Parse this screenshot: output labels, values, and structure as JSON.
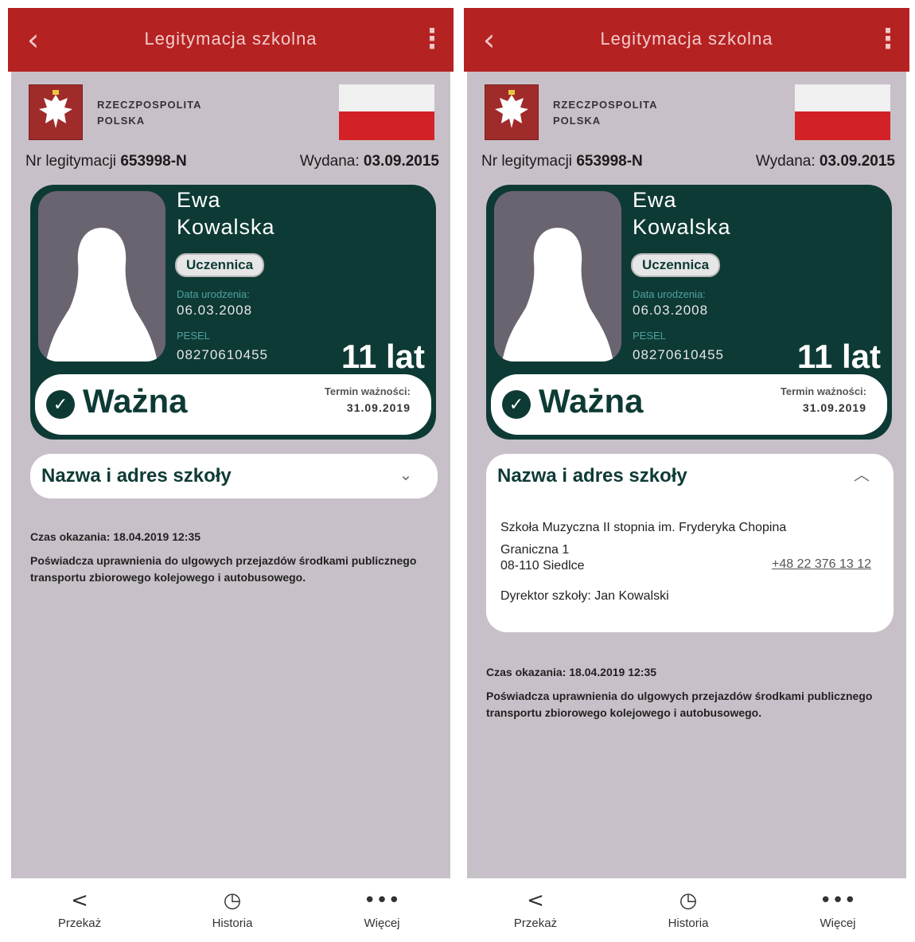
{
  "screens": [
    {
      "appbar": {
        "title": "Legitymacja szkolna",
        "back": "‹",
        "more": "⋮"
      },
      "header": {
        "rp_line1": "RZECZPOSPOLITA",
        "rp_line2": "POLSKA"
      },
      "id_row": {
        "nr_label": "Nr legitymacji ",
        "nr_value": "653998-N",
        "issued_label": "Wydana: ",
        "issued_value": "03.09.2015"
      },
      "card": {
        "first_name": "Ewa",
        "last_name": "Kowalska",
        "role": "Uczennica",
        "dob_label": "Data urodzenia:",
        "dob_value": "06.03.2008",
        "pesel_label": "PESEL",
        "pesel_value": "08270610455",
        "age": "11 lat",
        "status_icon": "check-icon",
        "status": "Ważna",
        "validity_label": "Termin ważności:",
        "validity_value": "31.09.2019"
      },
      "school": {
        "header": "Nazwa i adres szkoły",
        "chevron": "⌄",
        "expanded": false
      },
      "shown_time": "Czas okazania: 18.04.2019 12:35",
      "certification": "Poświadcza uprawnienia do ulgowych przejazdów środkami publicznego transportu zbiorowego kolejowego i autobusowego.",
      "nav": [
        {
          "icon": "share-icon",
          "glyph": "<",
          "label": "Przekaż"
        },
        {
          "icon": "history-icon",
          "glyph": "◷",
          "label": "Historia"
        },
        {
          "icon": "more-icon",
          "glyph": "•••",
          "label": "Więcej"
        }
      ]
    },
    {
      "appbar": {
        "title": "Legitymacja szkolna",
        "back": "‹",
        "more": "⋮"
      },
      "header": {
        "rp_line1": "RZECZPOSPOLITA",
        "rp_line2": "POLSKA"
      },
      "id_row": {
        "nr_label": "Nr legitymacji ",
        "nr_value": "653998-N",
        "issued_label": "Wydana: ",
        "issued_value": "03.09.2015"
      },
      "card": {
        "first_name": "Ewa",
        "last_name": "Kowalska",
        "role": "Uczennica",
        "dob_label": "Data urodzenia:",
        "dob_value": "06.03.2008",
        "pesel_label": "PESEL",
        "pesel_value": "08270610455",
        "age": "11 lat",
        "status_icon": "check-icon",
        "status": "Ważna",
        "validity_label": "Termin ważności:",
        "validity_value": "31.09.2019"
      },
      "school": {
        "header": "Nazwa i adres szkoły",
        "chevron": "︿",
        "expanded": true,
        "name": "Szkoła Muzyczna II stopnia im. Fryderyka Chopina",
        "street": "Graniczna 1",
        "city": "08-110 Siedlce",
        "phone": "+48 22 376 13 12",
        "director": "Dyrektor szkoły: Jan Kowalski"
      },
      "shown_time": "Czas okazania: 18.04.2019 12:35",
      "certification": "Poświadcza uprawnienia do ulgowych przejazdów środkami publicznego transportu zbiorowego kolejowego i autobusowego.",
      "nav": [
        {
          "icon": "share-icon",
          "glyph": "<",
          "label": "Przekaż"
        },
        {
          "icon": "history-icon",
          "glyph": "◷",
          "label": "Historia"
        },
        {
          "icon": "more-icon",
          "glyph": "•••",
          "label": "Więcej"
        }
      ]
    }
  ],
  "colors": {
    "appbar": "#b52222",
    "card": "#0e3a35",
    "background": "#c8c0c8",
    "flag_red": "#d32226"
  }
}
